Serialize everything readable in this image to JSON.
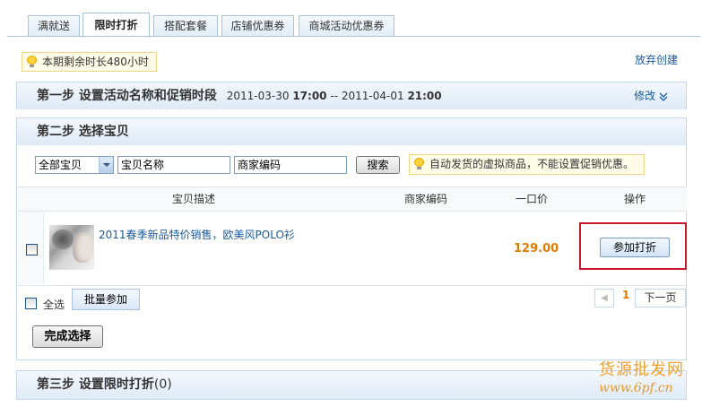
{
  "tabs": [
    {
      "label": "满就送",
      "active": false
    },
    {
      "label": "限时打折",
      "active": true
    },
    {
      "label": "搭配套餐",
      "active": false
    },
    {
      "label": "店铺优惠券",
      "active": false
    },
    {
      "label": "商城活动优惠券",
      "active": false
    }
  ],
  "notice": {
    "text": "本期剩余时长480小时",
    "icon": "lightbulb-icon"
  },
  "abandon_link": "放弃创建",
  "step1": {
    "title": "第一步 设置活动名称和促销时段",
    "start_date": "2011-03-30",
    "start_time": "17:00",
    "separator": "--",
    "end_date": "2011-04-01",
    "end_time": "21:00",
    "modify_label": "修改",
    "modify_icon": "double-chevron-down-icon"
  },
  "step2": {
    "title": "第二步 选择宝贝",
    "filter": {
      "category_selected": "全部宝贝",
      "name_value": "宝贝名称",
      "code_value": "商家编码",
      "search_label": "搜索",
      "warning": "自动发货的虚拟商品，不能设置促销优惠。"
    },
    "table": {
      "headers": {
        "desc": "宝贝描述",
        "code": "商家编码",
        "price": "一口价",
        "action": "操作"
      },
      "rows": [
        {
          "title": "2011春季新品特价销售，欧美风POLO衫",
          "code": "",
          "price": "129.00",
          "action_label": "参加打折"
        }
      ]
    },
    "select_all_label": "全选",
    "batch_label": "批量参加",
    "pager": {
      "prev": "◀",
      "current": "1",
      "next": "下一页"
    },
    "done_label": "完成选择"
  },
  "step3": {
    "title": "第三步 设置限时打折",
    "count": "(0)"
  },
  "watermark": {
    "line1": "货源批发网",
    "line2": "www.6pf.cn"
  },
  "colors": {
    "link": "#1a5a9a",
    "price": "#e07b00",
    "highlight_box": "#c8182b",
    "panel_border": "#c5d7ea"
  }
}
